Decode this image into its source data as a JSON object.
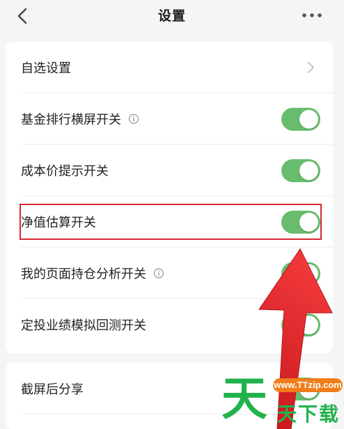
{
  "header": {
    "title": "设置"
  },
  "settings": {
    "items": [
      {
        "label": "自选设置",
        "type": "link"
      },
      {
        "label": "基金排行横屏开关",
        "type": "toggle",
        "info": true,
        "on": true
      },
      {
        "label": "成本价提示开关",
        "type": "toggle",
        "info": false,
        "on": true
      },
      {
        "label": "净值估算开关",
        "type": "toggle",
        "info": false,
        "on": true
      },
      {
        "label": "我的页面持仓分析开关",
        "type": "toggle",
        "info": true,
        "on": true
      },
      {
        "label": "定投业绩模拟回测开关",
        "type": "toggle",
        "info": false,
        "on": true
      }
    ],
    "second_group": [
      {
        "label": "截屏后分享",
        "type": "toggle",
        "on": true
      }
    ]
  },
  "colors": {
    "toggle_on": "#67bd6d",
    "highlight": "#d8282f",
    "arrow": "#e8282c"
  },
  "watermark": {
    "big_char": "天",
    "url": "www.TTzip.com",
    "small_text": "天下载"
  }
}
